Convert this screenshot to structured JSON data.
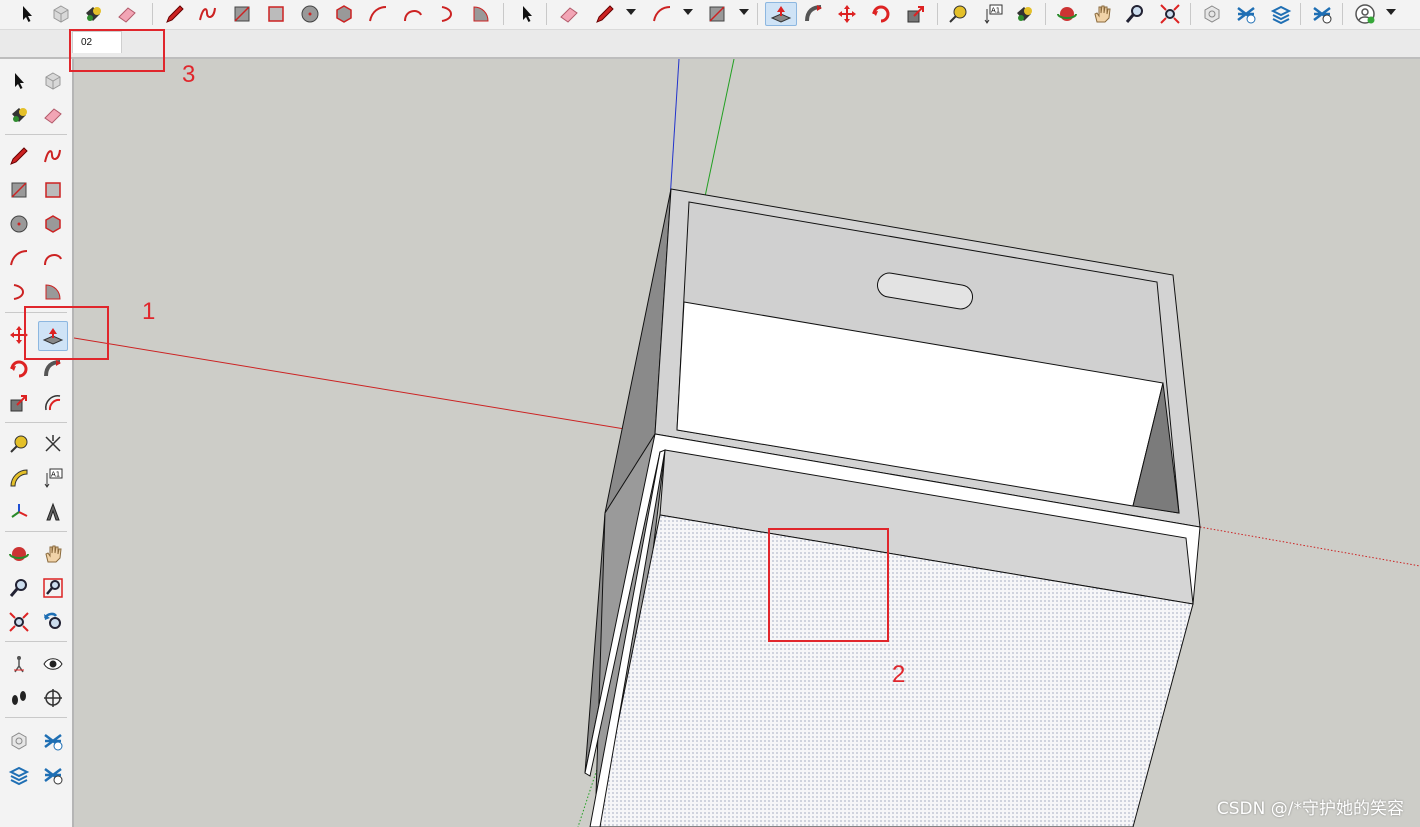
{
  "top_toolbar": {
    "tools": [
      {
        "name": "select",
        "icon": "select-arrow-icon"
      },
      {
        "name": "make-component",
        "icon": "component-icon"
      },
      {
        "name": "paint-bucket",
        "icon": "paint-bucket-icon"
      },
      {
        "name": "eraser",
        "icon": "eraser-icon"
      },
      {
        "name": "line",
        "icon": "pencil-icon"
      },
      {
        "name": "freehand",
        "icon": "freehand-icon"
      },
      {
        "name": "rectangle",
        "icon": "rectangle-icon"
      },
      {
        "name": "rotated-rectangle",
        "icon": "rotated-rectangle-icon"
      },
      {
        "name": "circle",
        "icon": "circle-icon"
      },
      {
        "name": "polygon",
        "icon": "polygon-icon"
      },
      {
        "name": "arc",
        "icon": "arc-icon"
      },
      {
        "name": "two-point-arc",
        "icon": "two-point-arc-icon"
      },
      {
        "name": "three-point-arc",
        "icon": "three-point-arc-icon"
      },
      {
        "name": "pie",
        "icon": "pie-icon"
      },
      {
        "name": "select-2",
        "icon": "select-arrow-icon"
      },
      {
        "name": "eraser-2",
        "icon": "eraser-icon"
      },
      {
        "name": "line-dropdown",
        "icon": "pencil-icon"
      },
      {
        "name": "arc-dropdown",
        "icon": "arc-icon"
      },
      {
        "name": "shape-dropdown",
        "icon": "rectangle-icon"
      },
      {
        "name": "push-pull",
        "icon": "push-pull-icon"
      },
      {
        "name": "follow-me",
        "icon": "follow-me-icon"
      },
      {
        "name": "move",
        "icon": "move-icon"
      },
      {
        "name": "rotate",
        "icon": "rotate-icon"
      },
      {
        "name": "scale",
        "icon": "scale-icon"
      },
      {
        "name": "tape-measure",
        "icon": "tape-measure-icon"
      },
      {
        "name": "text",
        "icon": "text-icon"
      },
      {
        "name": "paint",
        "icon": "paint-bucket-icon"
      },
      {
        "name": "orbit",
        "icon": "orbit-icon"
      },
      {
        "name": "pan",
        "icon": "pan-hand-icon"
      },
      {
        "name": "zoom",
        "icon": "zoom-icon"
      },
      {
        "name": "zoom-extents",
        "icon": "zoom-extents-icon"
      },
      {
        "name": "warehouse-models",
        "icon": "warehouse-icon"
      },
      {
        "name": "warehouse-extensions",
        "icon": "extension-warehouse-icon"
      },
      {
        "name": "share-model",
        "icon": "share-model-icon"
      },
      {
        "name": "extension-manager",
        "icon": "extension-manager-icon"
      },
      {
        "name": "account",
        "icon": "account-icon"
      }
    ],
    "text_tool_label": "A1"
  },
  "scene_tab": {
    "label": "02"
  },
  "left_toolbar": {
    "text_tool_label": "A1",
    "tools": [
      "select-arrow-icon",
      "component-icon",
      "paint-bucket-icon",
      "eraser-icon",
      "pencil-icon",
      "freehand-icon",
      "rectangle-icon",
      "rotated-rectangle-icon",
      "circle-icon",
      "polygon-icon",
      "arc-icon",
      "two-point-arc-icon",
      "three-point-arc-icon",
      "pie-icon",
      "move-icon",
      "push-pull-icon",
      "rotate-icon",
      "follow-me-icon",
      "scale-icon",
      "offset-icon",
      "tape-measure-icon",
      "dimension-icon",
      "protractor-icon",
      "text-icon",
      "axes-icon",
      "3d-text-icon",
      "orbit-icon",
      "pan-hand-icon",
      "zoom-icon",
      "zoom-window-icon",
      "zoom-extents-icon",
      "previous-view-icon",
      "position-camera-icon",
      "look-around-icon",
      "walk-icon",
      "section-plane-icon",
      "warehouse-icon",
      "extension-warehouse-icon",
      "share-model-icon",
      "extension-manager-icon"
    ]
  },
  "annotations": {
    "label_1": "1",
    "label_2": "2",
    "label_3": "3"
  },
  "colors": {
    "annotation_red": "#e0262c",
    "viewport_bg": "#cdcdc8",
    "active_tool_bg": "#cfe3f6"
  },
  "watermark": "CSDN @/*守护她的笑容"
}
